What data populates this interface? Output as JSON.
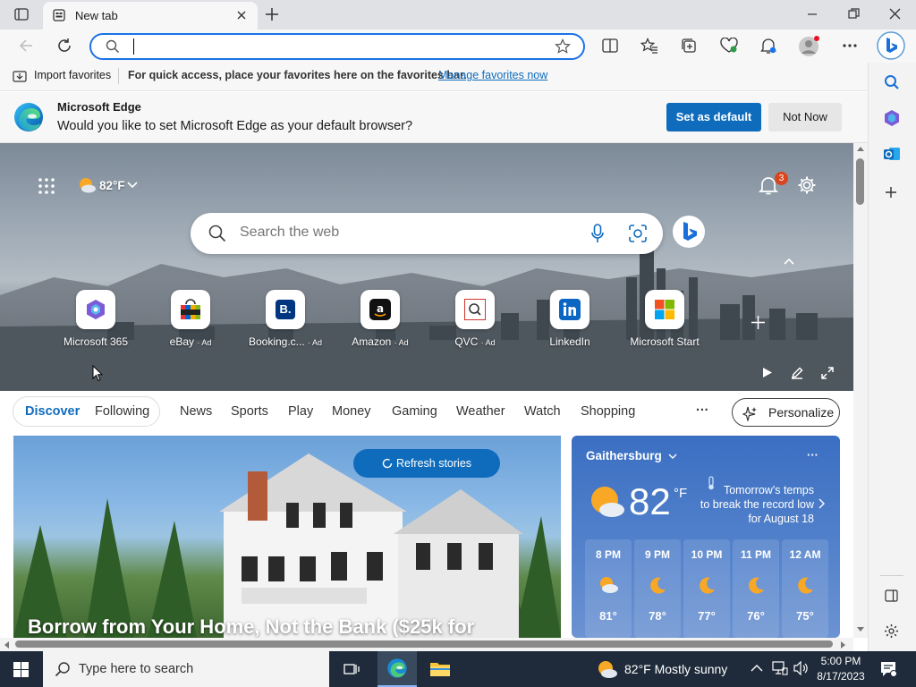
{
  "browser": {
    "tab_title": "New tab",
    "address_value": "",
    "favorites_bar": {
      "import_label": "Import favorites",
      "message": "For quick access, place your favorites here on the favorites bar.",
      "manage_link": "Manage favorites now"
    },
    "infobar": {
      "title": "Microsoft Edge",
      "message": "Would you like to set Microsoft Edge as your default browser?",
      "set_default": "Set as default",
      "not_now": "Not Now"
    }
  },
  "newtab": {
    "weather_chip": "82°F",
    "notification_count": "3",
    "search_placeholder": "Search the web",
    "quick_links": [
      {
        "label": "Microsoft 365"
      },
      {
        "label": "eBay",
        "ad": "· Ad"
      },
      {
        "label": "Booking.c...",
        "ad": "· Ad"
      },
      {
        "label": "Amazon",
        "ad": "· Ad"
      },
      {
        "label": "QVC",
        "ad": "· Ad"
      },
      {
        "label": "LinkedIn"
      },
      {
        "label": "Microsoft Start"
      }
    ],
    "feed_tabs": [
      "Discover",
      "Following",
      "News",
      "Sports",
      "Play",
      "Money",
      "Gaming",
      "Weather",
      "Watch",
      "Shopping"
    ],
    "more": "···",
    "personalize": "Personalize",
    "refresh": "Refresh stories",
    "headline": "Borrow from Your Home, Not the Bank ($25k for",
    "weather": {
      "location": "Gaithersburg",
      "temp": "82",
      "unit": "°F",
      "note": "Tomorrow's temps to break the record low for August 18",
      "note_lines": [
        "Tomorrow's temps",
        "to break the record low",
        "for August 18"
      ],
      "hours": [
        {
          "time": "8 PM",
          "temp": "81°",
          "icon": "partly-cloudy-night-icon"
        },
        {
          "time": "9 PM",
          "temp": "78°",
          "icon": "moon-icon"
        },
        {
          "time": "10 PM",
          "temp": "77°",
          "icon": "moon-icon"
        },
        {
          "time": "11 PM",
          "temp": "76°",
          "icon": "moon-icon"
        },
        {
          "time": "12 AM",
          "temp": "75°",
          "icon": "moon-icon"
        }
      ]
    }
  },
  "taskbar": {
    "search_placeholder": "Type here to search",
    "weather": "82°F  Mostly sunny",
    "time": "5:00 PM",
    "date": "8/17/2023"
  },
  "colors": {
    "accent": "#0f6cbd",
    "link": "#0f6cbd",
    "taskbar": "#1f2b3a",
    "weather_card": "#4a79c6"
  }
}
